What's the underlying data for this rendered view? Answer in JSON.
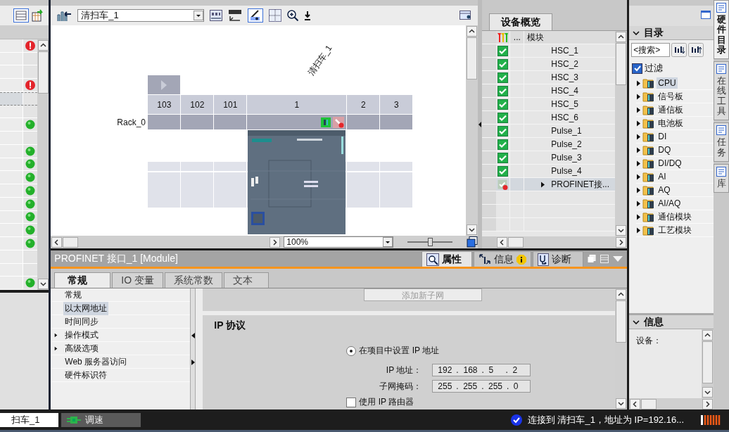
{
  "left_panel": {
    "rows": [
      {
        "kind": "error",
        "selected": false
      },
      {
        "kind": "empty",
        "selected": false
      },
      {
        "kind": "empty",
        "selected": false
      },
      {
        "kind": "error",
        "selected": false
      },
      {
        "kind": "empty",
        "selected": true
      },
      {
        "kind": "empty",
        "selected": false
      },
      {
        "kind": "ok",
        "selected": false
      },
      {
        "kind": "empty",
        "selected": false
      },
      {
        "kind": "ok",
        "selected": false
      },
      {
        "kind": "ok",
        "selected": false
      },
      {
        "kind": "ok",
        "selected": false
      },
      {
        "kind": "ok",
        "selected": false
      },
      {
        "kind": "ok",
        "selected": false
      },
      {
        "kind": "ok",
        "selected": false
      },
      {
        "kind": "ok",
        "selected": false
      },
      {
        "kind": "ok",
        "selected": false
      },
      {
        "kind": "empty",
        "selected": false
      },
      {
        "kind": "empty",
        "selected": false
      },
      {
        "kind": "ok",
        "selected": false
      }
    ]
  },
  "editor": {
    "device_selector": "清扫车_1",
    "device_label": "清扫车_1",
    "rack": "Rack_0",
    "slots": [
      {
        "label": "103",
        "module": false
      },
      {
        "label": "102",
        "module": false
      },
      {
        "label": "101",
        "module": false
      },
      {
        "label": "1",
        "module": true
      },
      {
        "label": "2",
        "module": false
      },
      {
        "label": "3",
        "module": false
      }
    ],
    "zoom": "100%",
    "zoom_slider": {
      "level": 0.5
    }
  },
  "overview": {
    "tab": "设备概览",
    "columns": [
      "...",
      "模块"
    ],
    "rows": [
      {
        "module": "HSC_1",
        "kind": "ok",
        "expandable": false,
        "selected": false
      },
      {
        "module": "HSC_2",
        "kind": "ok",
        "expandable": false,
        "selected": false
      },
      {
        "module": "HSC_3",
        "kind": "ok",
        "expandable": false,
        "selected": false
      },
      {
        "module": "HSC_4",
        "kind": "ok",
        "expandable": false,
        "selected": false
      },
      {
        "module": "HSC_5",
        "kind": "ok",
        "expandable": false,
        "selected": false
      },
      {
        "module": "HSC_6",
        "kind": "ok",
        "expandable": false,
        "selected": false
      },
      {
        "module": "Pulse_1",
        "kind": "ok",
        "expandable": false,
        "selected": false
      },
      {
        "module": "Pulse_2",
        "kind": "ok",
        "expandable": false,
        "selected": false
      },
      {
        "module": "Pulse_3",
        "kind": "ok",
        "expandable": false,
        "selected": false
      },
      {
        "module": "Pulse_4",
        "kind": "ok",
        "expandable": false,
        "selected": false
      },
      {
        "module": "PROFINET接...",
        "kind": "error",
        "expandable": true,
        "selected": true
      }
    ]
  },
  "inspector": {
    "title": "PROFINET 接口_1 [Module]",
    "tabs": [
      {
        "label": "属性",
        "kind": "properties",
        "selected": true
      },
      {
        "label": "信息",
        "kind": "info",
        "selected": false
      },
      {
        "label": "诊断",
        "kind": "diagnostics",
        "selected": false
      }
    ],
    "subtabs": [
      {
        "label": "常规",
        "selected": true
      },
      {
        "label": "IO 变量",
        "selected": false
      },
      {
        "label": "系统常数",
        "selected": false
      },
      {
        "label": "文本",
        "selected": false
      }
    ],
    "nav": [
      {
        "label": "常规",
        "selected": false,
        "expandable": false
      },
      {
        "label": "以太网地址",
        "selected": true,
        "expandable": false
      },
      {
        "label": "时间同步",
        "selected": false,
        "expandable": false
      },
      {
        "label": "操作模式",
        "selected": false,
        "expandable": true
      },
      {
        "label": "高级选项",
        "selected": false,
        "expandable": true
      },
      {
        "label": "Web 服务器访问",
        "selected": false,
        "expandable": false
      },
      {
        "label": "硬件标识符",
        "selected": false,
        "expandable": false
      }
    ],
    "add_subnet_button": {
      "label": "添加新子网",
      "disabled": true
    },
    "section_title": "IP 协议",
    "radio": {
      "label": "在项目中设置 IP 地址",
      "selected": true
    },
    "fields": [
      {
        "label": "IP 地址：",
        "separator": ".",
        "octets": [
          "192",
          "168",
          "5",
          "2"
        ]
      },
      {
        "label": "子网掩码：",
        "separator": ".",
        "octets": [
          "255",
          "255",
          "255",
          "0"
        ]
      }
    ],
    "router_checkbox": {
      "label": "使用 IP 路由器",
      "checked": false
    }
  },
  "catalog": {
    "title": "目录",
    "search": {
      "placeholder": "<搜索>"
    },
    "filter": {
      "label": "过滤",
      "checked": true
    },
    "items": [
      {
        "label": "CPU",
        "selected": true
      },
      {
        "label": "信号板",
        "selected": false
      },
      {
        "label": "通信板",
        "selected": false
      },
      {
        "label": "电池板",
        "selected": false
      },
      {
        "label": "DI",
        "selected": false
      },
      {
        "label": "DQ",
        "selected": false
      },
      {
        "label": "DI/DQ",
        "selected": false
      },
      {
        "label": "AI",
        "selected": false
      },
      {
        "label": "AQ",
        "selected": false
      },
      {
        "label": "AI/AQ",
        "selected": false
      },
      {
        "label": "通信模块",
        "selected": false
      },
      {
        "label": "工艺模块",
        "selected": false
      }
    ]
  },
  "info_panel": {
    "title": "信息",
    "text": "设备："
  },
  "side_tabs": [
    {
      "label": "硬件目录",
      "selected": true
    },
    {
      "label": "在线工具",
      "selected": false
    },
    {
      "label": "任务",
      "selected": false
    },
    {
      "label": "库",
      "selected": false
    }
  ],
  "status_bar": {
    "tabs": [
      {
        "label": "扫车_1",
        "selected": true
      },
      {
        "label": "调速",
        "selected": false
      }
    ],
    "message": "连接到 清扫车_1，地址为 IP=192.16..."
  }
}
